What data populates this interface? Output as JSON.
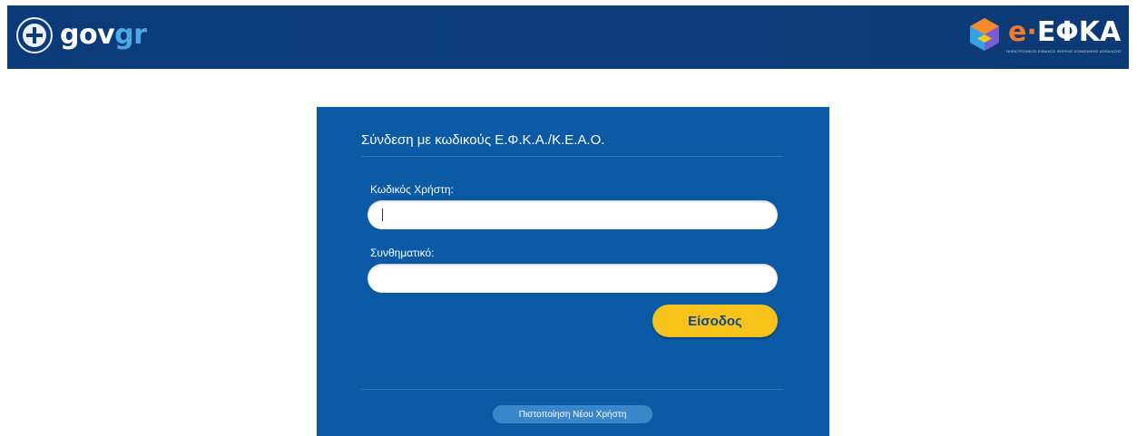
{
  "header": {
    "gov_logo": {
      "part1": "gov",
      "part2": "gr",
      "emblem_icon": "greek-cross-emblem-icon"
    },
    "efka_logo": {
      "prefix": "e",
      "separator": "·",
      "name": "ΕΦΚΑ",
      "subtitle": "ΗΛΕΚΤΡΟΝΙΚΟΣ ΕΘΝΙΚΟΣ ΦΟΡΕΑΣ ΚΟΙΝΩΝΙΚΗΣ ΑΣΦΑΛΙΣΗΣ",
      "mark_icon": "efka-hexagon-icon"
    }
  },
  "login": {
    "title": "Σύνδεση με κωδικούς Ε.Φ.Κ.Α./Κ.Ε.Α.Ο.",
    "username": {
      "label": "Κωδικός Χρήστη:",
      "value": ""
    },
    "password": {
      "label": "Συνθηματικό:",
      "value": ""
    },
    "submit_label": "Είσοδος",
    "verify_label": "Πιστοποίηση Νέου Χρήστη"
  },
  "colors": {
    "header_bg": "#0b3b78",
    "panel_bg": "#0a5aa6",
    "button_yellow": "#f7c21a",
    "gr_accent": "#4aa9e6",
    "efka_orange": "#f37a2a"
  }
}
